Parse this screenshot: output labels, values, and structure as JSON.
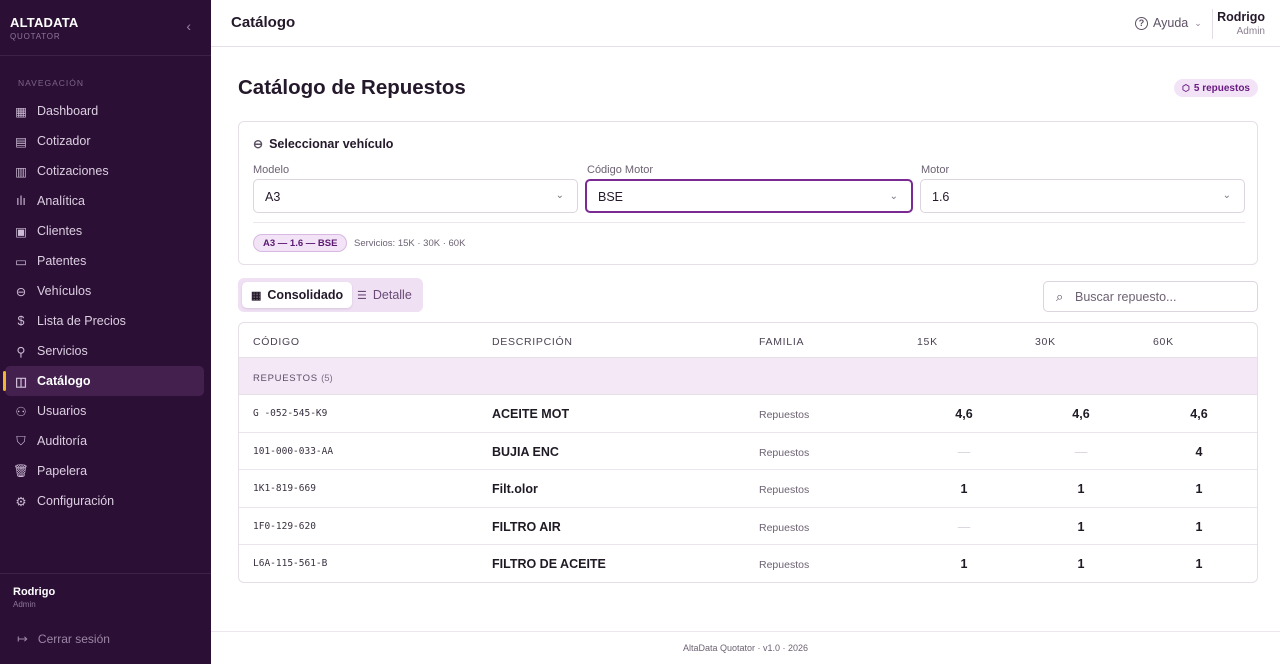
{
  "brand": {
    "name": "ALTADATA",
    "sub": "QUOTATOR",
    "collapse_icon": "‹"
  },
  "nav": {
    "section": "NAVEGACIÓN",
    "items": [
      {
        "label": "Dashboard",
        "icon": "dashboard-icon",
        "glyph": "▦"
      },
      {
        "label": "Cotizador",
        "icon": "calculator-icon",
        "glyph": "▤"
      },
      {
        "label": "Cotizaciones",
        "icon": "document-icon",
        "glyph": "▥"
      },
      {
        "label": "Analítica",
        "icon": "bar-chart-icon",
        "glyph": "ılı"
      },
      {
        "label": "Clientes",
        "icon": "contact-card-icon",
        "glyph": "▣"
      },
      {
        "label": "Patentes",
        "icon": "plate-icon",
        "glyph": "▭"
      },
      {
        "label": "Vehículos",
        "icon": "car-icon",
        "glyph": "⊖"
      },
      {
        "label": "Lista de Precios",
        "icon": "dollar-icon",
        "glyph": "$"
      },
      {
        "label": "Servicios",
        "icon": "wrench-icon",
        "glyph": "⚲"
      },
      {
        "label": "Catálogo",
        "icon": "book-open-icon",
        "glyph": "◫",
        "active": true
      },
      {
        "label": "Usuarios",
        "icon": "users-icon",
        "glyph": "⚇"
      },
      {
        "label": "Auditoría",
        "icon": "shield-icon",
        "glyph": "⛉"
      },
      {
        "label": "Papelera",
        "icon": "trash-icon",
        "glyph": "🗑"
      },
      {
        "label": "Configuración",
        "icon": "gear-icon",
        "glyph": "⚙"
      }
    ]
  },
  "side_user": {
    "name": "Rodrigo",
    "role": "Admin"
  },
  "logout": {
    "label": "Cerrar sesión",
    "glyph": "↦"
  },
  "topbar": {
    "title": "Catálogo",
    "help_label": "Ayuda",
    "user_name": "Rodrigo",
    "user_role": "Admin"
  },
  "page": {
    "title": "Catálogo de Repuestos",
    "count_badge": "5 repuestos"
  },
  "vehicle": {
    "heading": "Seleccionar vehículo",
    "fields": [
      {
        "label": "Modelo",
        "value": "A3"
      },
      {
        "label": "Código Motor",
        "value": "BSE"
      },
      {
        "label": "Motor",
        "value": "1.6"
      }
    ],
    "combo": "A3 — 1.6 — BSE",
    "services": "Servicios: 15K · 30K · 60K"
  },
  "view": {
    "consolidated": "Consolidado",
    "detail": "Detalle"
  },
  "search": {
    "placeholder": "Buscar repuesto..."
  },
  "table": {
    "headers": {
      "code": "CÓDIGO",
      "desc": "DESCRIPCIÓN",
      "family": "FAMILIA",
      "k15": "15K",
      "k30": "30K",
      "k60": "60K"
    },
    "group": {
      "label": "REPUESTOS",
      "count": "(5)"
    },
    "rows": [
      {
        "code": "G -052-545-K9",
        "desc": "ACEITE MOT",
        "family": "Repuestos",
        "k15": "4,6",
        "k30": "4,6",
        "k60": "4,6"
      },
      {
        "code": "101-000-033-AA",
        "desc": "BUJIA ENC",
        "family": "Repuestos",
        "k15": "—",
        "k30": "—",
        "k60": "4"
      },
      {
        "code": "1K1-819-669",
        "desc": "Filt.olor",
        "family": "Repuestos",
        "k15": "1",
        "k30": "1",
        "k60": "1"
      },
      {
        "code": "1F0-129-620",
        "desc": "FILTRO AIR",
        "family": "Repuestos",
        "k15": "—",
        "k30": "1",
        "k60": "1"
      },
      {
        "code": "L6A-115-561-B",
        "desc": "FILTRO DE ACEITE",
        "family": "Repuestos",
        "k15": "1",
        "k30": "1",
        "k60": "1"
      }
    ]
  },
  "footer": {
    "text": "AltaData Quotator · v1.0 · 2026"
  },
  "colors": {
    "sidebar": "#2b0f35",
    "accent": "#7b2a93",
    "active_marker": "#f2b530",
    "badge_bg": "#f2e4f6"
  }
}
